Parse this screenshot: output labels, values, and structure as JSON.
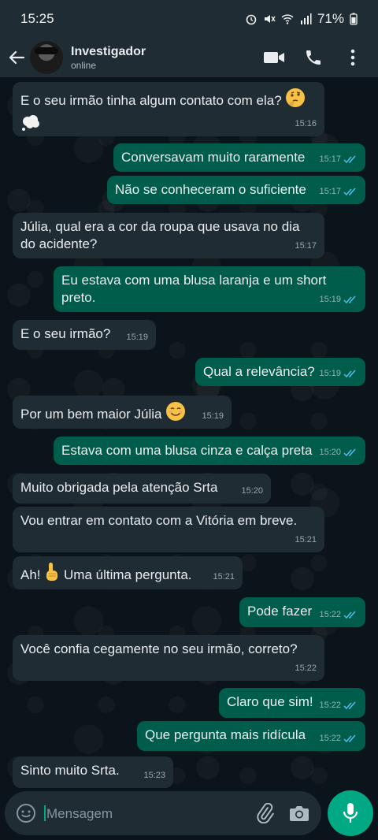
{
  "status_bar": {
    "time": "15:25",
    "battery": "71%"
  },
  "header": {
    "contact_name": "Investigador",
    "contact_status": "online"
  },
  "messages": [
    {
      "text": "E o seu irmão tinha algum contato com ela?",
      "time": "15:16",
      "dir": "in"
    },
    {
      "text": "Conversavam muito raramente",
      "time": "15:17",
      "dir": "out"
    },
    {
      "text": "Não se conheceram o suficiente",
      "time": "15:17",
      "dir": "out"
    },
    {
      "text": "Júlia, qual era a cor da roupa que usava no dia do acidente?",
      "time": "15:17",
      "dir": "in"
    },
    {
      "text": "Eu estava com uma blusa laranja e um short preto.",
      "time": "15:19",
      "dir": "out"
    },
    {
      "text": "E o seu irmão?",
      "time": "15:19",
      "dir": "in"
    },
    {
      "text": "Qual a relevância?",
      "time": "15:19",
      "dir": "out"
    },
    {
      "text": "Por um bem maior Júlia",
      "time": "15:19",
      "dir": "in"
    },
    {
      "text": "Estava com uma blusa cinza e calça preta",
      "time": "15:20",
      "dir": "out"
    },
    {
      "text": "Muito obrigada pela atenção Srta",
      "time": "15:20",
      "dir": "in"
    },
    {
      "text": "Vou entrar em contato com a Vitória em breve.",
      "time": "15:21",
      "dir": "in"
    },
    {
      "text_a": "Ah!",
      "text_b": "Uma última pergunta.",
      "time": "15:21",
      "dir": "in"
    },
    {
      "text": "Pode fazer",
      "time": "15:22",
      "dir": "out"
    },
    {
      "text": "Você confia cegamente no seu irmão, correto?",
      "time": "15:22",
      "dir": "in"
    },
    {
      "text": "Claro que sim!",
      "time": "15:22",
      "dir": "out"
    },
    {
      "text": "Que pergunta mais ridícula",
      "time": "15:22",
      "dir": "out"
    },
    {
      "text": "Sinto muito Srta.",
      "time": "15:23",
      "dir": "in"
    }
  ],
  "composer": {
    "placeholder": "Mensagem"
  },
  "colors": {
    "incoming_bubble": "#1f2c34",
    "outgoing_bubble": "#005c4b",
    "read_ticks": "#53bdeb",
    "accent": "#00a884"
  },
  "icons": [
    "back-arrow-icon",
    "video-call-icon",
    "phone-icon",
    "more-vert-icon",
    "emoji-icon",
    "attach-icon",
    "camera-icon",
    "mic-icon"
  ]
}
